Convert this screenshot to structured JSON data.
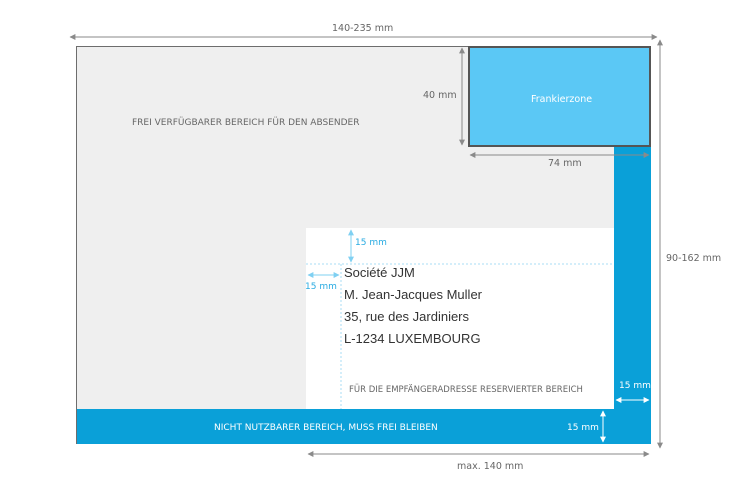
{
  "colors": {
    "envelope": "#efefef",
    "envelope_border": "#6d6d6d",
    "stamp_zone": "#5bc8f5",
    "unusable_zone": "#0aa0d8",
    "address_zone": "#ffffff",
    "dimension_line": "#8a8a8a",
    "inner_dimension": "#7fd0f2"
  },
  "dimensions": {
    "width": "140-235 mm",
    "height": "90-162 mm",
    "stamp_height": "40 mm",
    "stamp_width": "74 mm",
    "address_top_margin": "15 mm",
    "address_left_margin": "15 mm",
    "right_margin": "15 mm",
    "bottom_margin": "15 mm",
    "address_max_width": "max. 140 mm"
  },
  "zones": {
    "sender_area": "FREI VERFÜGBARER BEREICH FÜR DEN ABSENDER",
    "stamp_zone": "Frankierzone",
    "recipient_area": "FÜR DIE EMPFÄNGERADRESSE RESERVIERTER BEREICH",
    "unusable_area": "NICHT NUTZBARER BEREICH, MUSS FREI BLEIBEN"
  },
  "address": {
    "line1": "Société JJM",
    "line2": "M. Jean-Jacques Muller",
    "line3": "35, rue des Jardiniers",
    "line4": "L-1234 LUXEMBOURG"
  }
}
